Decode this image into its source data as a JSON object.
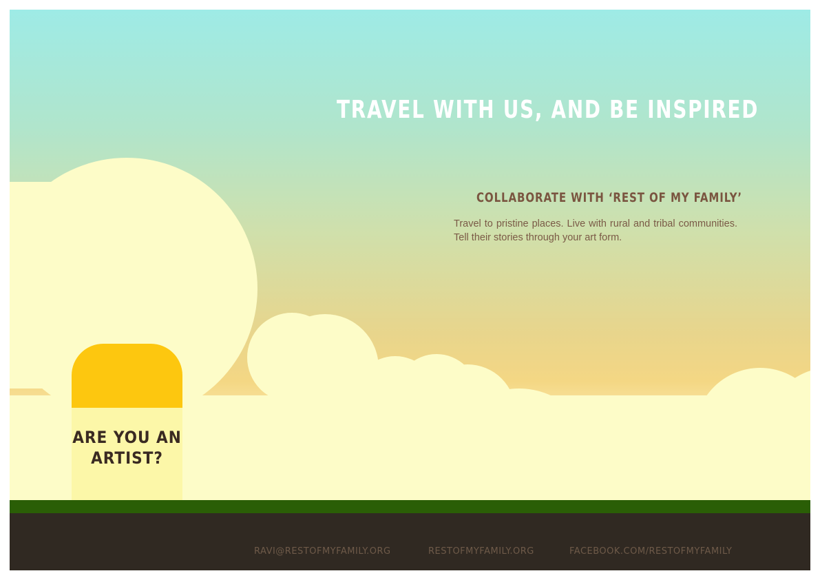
{
  "poster": {
    "headline": "TRAVEL WITH US, AND BE INSPIRED",
    "collab_heading": "COLLABORATE WITH ‘REST OF MY FAMILY’",
    "collab_body": "Travel to pristine places. Live with rural and tribal communities. Tell their stories through your art form.",
    "milestone_line1": "ARE YOU AN",
    "milestone_line2": "ARTIST?"
  },
  "footer": {
    "email": "RAVI@RESTOFMYFAMILY.ORG",
    "website": "RESTOFMYFAMILY.ORG",
    "facebook": "FACEBOOK.COM/RESTOFMYFAMILY"
  },
  "colors": {
    "sky_top": "#9eebe6",
    "sky_bottom": "#fbb555",
    "cloud": "#fdfcc8",
    "milestone_cap": "#fdc70f",
    "milestone_base": "#fcf7a8",
    "grass": "#2a5e06",
    "road": "#302922",
    "headline_text": "#ffffff",
    "subheading_text": "#7a5540",
    "footer_text": "#6e5a49"
  }
}
